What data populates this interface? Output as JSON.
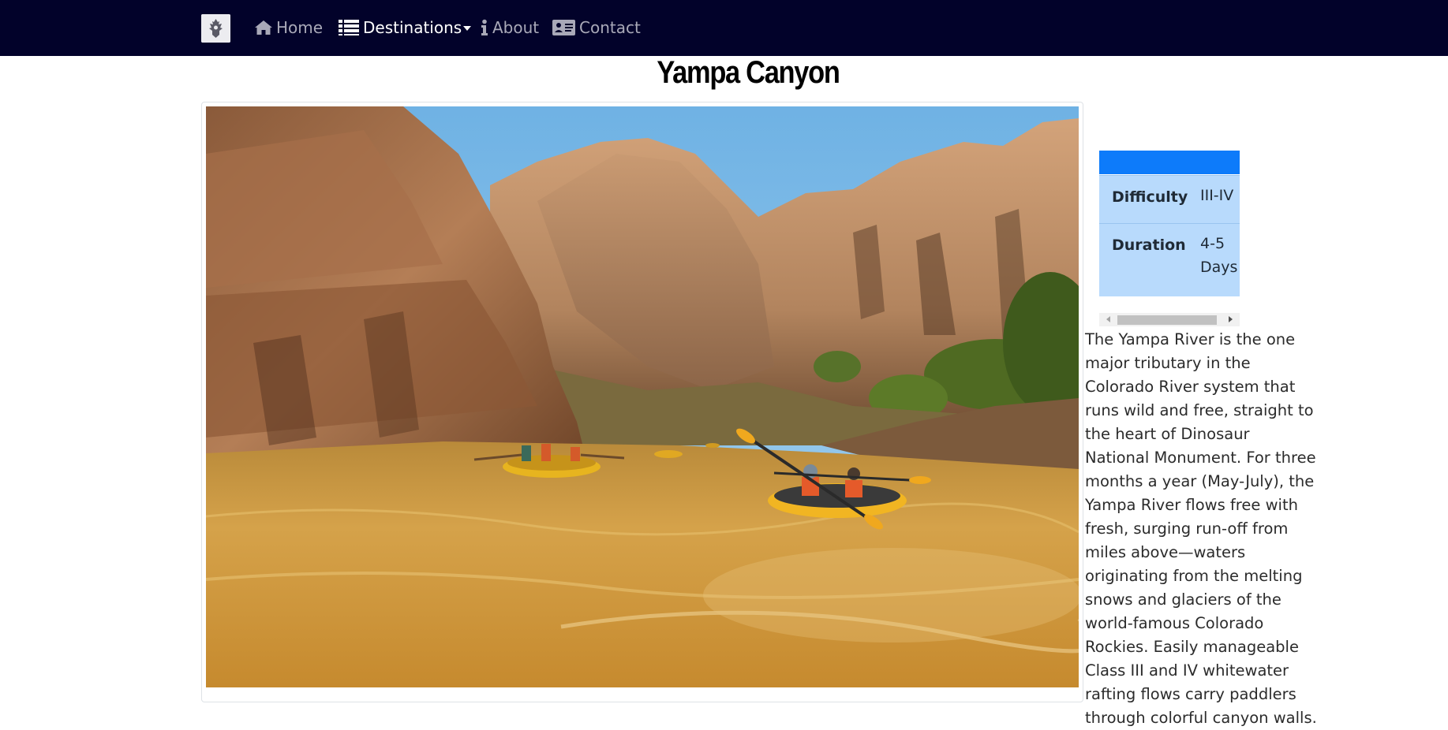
{
  "nav": {
    "items": [
      {
        "label": "Home",
        "icon": "home-icon"
      },
      {
        "label": "Destinations",
        "icon": "list-icon",
        "has_dropdown": true
      },
      {
        "label": "About",
        "icon": "info-icon"
      },
      {
        "label": "Contact",
        "icon": "contact-card-icon"
      }
    ],
    "active_item": "Destinations",
    "logo_icon": "eagle-crest-logo"
  },
  "page": {
    "title": "Yampa Canyon"
  },
  "photo": {
    "subject": "rafting-canyon-photo"
  },
  "info_table": {
    "header": "",
    "rows": [
      {
        "label": "Difficulty",
        "value": "III-IV"
      },
      {
        "label": "Duration",
        "value": "4-5 Days"
      }
    ]
  },
  "description": "The Yampa River is the one major tributary in the Colorado River system that runs wild and free, straight to the heart of Dinosaur National Monument. For three months a year (May-July), the Yampa River flows free with fresh, surging run-off from miles above—waters originating from the melting snows and glaciers of the world-famous Colorado Rockies. Easily manageable Class III and IV whitewater rafting flows carry paddlers through colorful canyon walls.",
  "colors": {
    "navbar": "#02022a",
    "table_header": "#0d7bfa",
    "table_row": "#b8dafc",
    "nav_text": "#a9a9b8",
    "nav_text_active": "#ffffff"
  }
}
